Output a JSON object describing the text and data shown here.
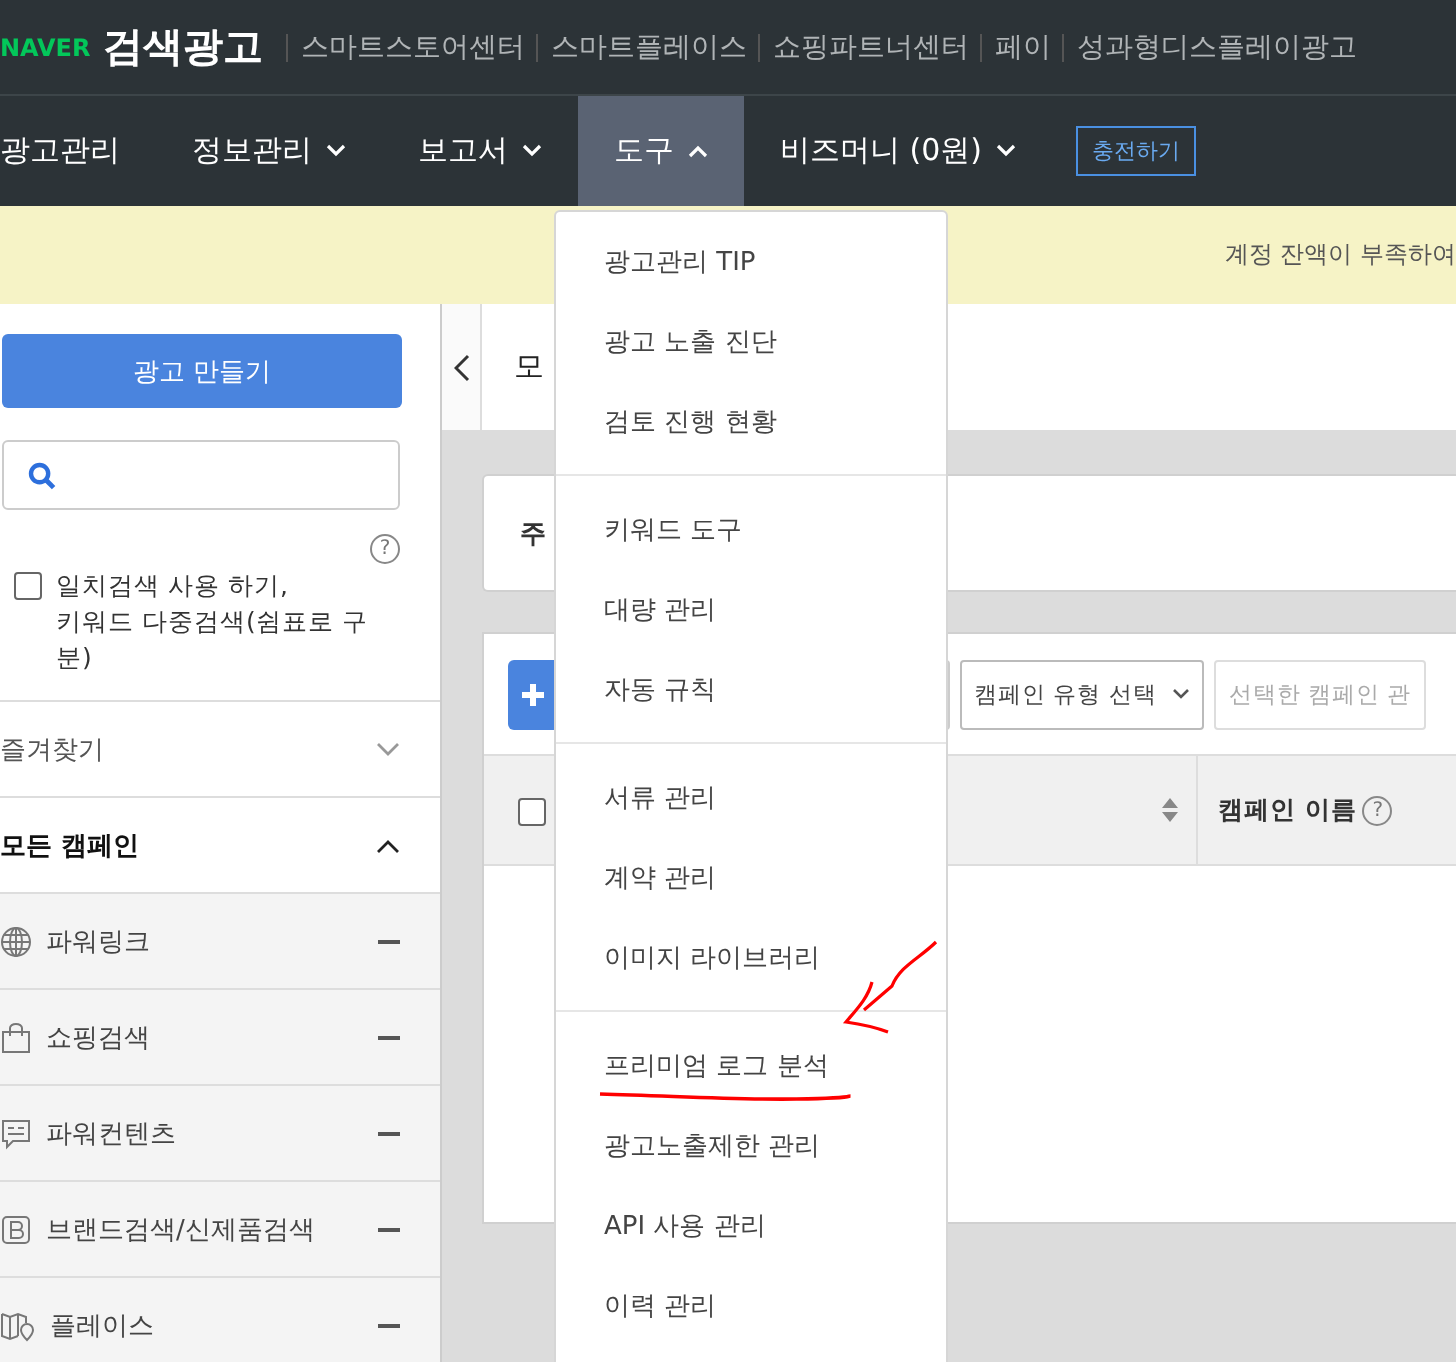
{
  "header": {
    "logo": "NAVER",
    "product": "검색광고",
    "links": [
      "스마트스토어센터",
      "스마트플레이스",
      "쇼핑파트너센터",
      "페이",
      "성과형디스플레이광고"
    ]
  },
  "nav": {
    "items": [
      {
        "label": "광고관리",
        "has_caret": false,
        "selected": false
      },
      {
        "label": "정보관리",
        "has_caret": true,
        "expanded": false,
        "selected": false
      },
      {
        "label": "보고서",
        "has_caret": true,
        "expanded": false,
        "selected": false
      },
      {
        "label": "도구",
        "has_caret": true,
        "expanded": true,
        "selected": true
      },
      {
        "label": "비즈머니 (0원)",
        "has_caret": true,
        "expanded": false,
        "selected": false
      }
    ],
    "charge_button": "충전하기"
  },
  "notice": "계정 잔액이 부족하여",
  "sidebar": {
    "create_button": "광고 만들기",
    "help": "?",
    "exact_search": {
      "lines": [
        "일치검색 사용 하기,",
        "키워드 다중검색(쉼표로 구분)"
      ],
      "checked": false
    },
    "sections": [
      {
        "label": "즐겨찾기",
        "expanded": false,
        "bold": false
      },
      {
        "label": "모든 캠페인",
        "expanded": true,
        "bold": true
      }
    ],
    "campaign_types": [
      {
        "label": "파워링크",
        "kind": "globe"
      },
      {
        "label": "쇼핑검색",
        "kind": "bag"
      },
      {
        "label": "파워컨텐츠",
        "kind": "chat"
      },
      {
        "label": "브랜드검색/신제품검색",
        "kind": "brand"
      },
      {
        "label": "플레이스",
        "kind": "map"
      }
    ]
  },
  "main": {
    "title": "모",
    "summary_label": "주",
    "toolbar": {
      "type_select": "캠페인 유형 선택",
      "manage_select": "선택한 캠페인 관"
    },
    "table": {
      "select_all": false,
      "columns": [
        {
          "label": "캠페인 이름",
          "help": "?"
        }
      ]
    }
  },
  "dropdown": {
    "groups": [
      [
        {
          "label": "광고관리 TIP",
          "annotated": false
        },
        {
          "label": "광고 노출 진단",
          "annotated": false
        },
        {
          "label": "검토 진행 현황",
          "annotated": false
        }
      ],
      [
        {
          "label": "키워드 도구",
          "annotated": false
        },
        {
          "label": "대량 관리",
          "annotated": false
        },
        {
          "label": "자동 규칙",
          "annotated": false
        }
      ],
      [
        {
          "label": "서류 관리",
          "annotated": false
        },
        {
          "label": "계약 관리",
          "annotated": false
        },
        {
          "label": "이미지 라이브러리",
          "annotated": false
        }
      ],
      [
        {
          "label": "프리미엄 로그 분석",
          "annotated": true
        },
        {
          "label": "광고노출제한 관리",
          "annotated": false
        },
        {
          "label": "API 사용 관리",
          "annotated": false
        },
        {
          "label": "이력 관리",
          "annotated": false
        }
      ]
    ]
  }
}
